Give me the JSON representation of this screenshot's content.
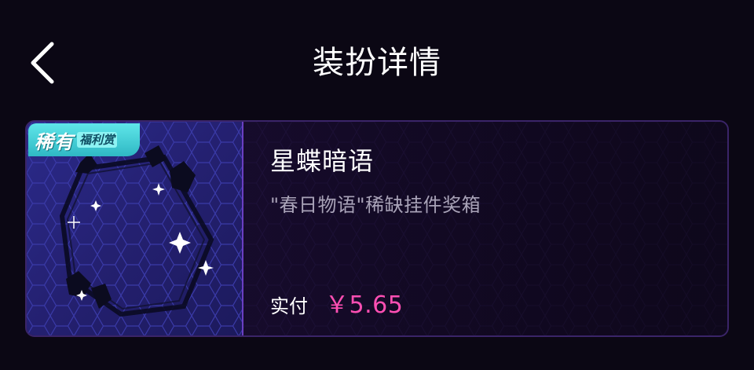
{
  "header": {
    "title": "装扮详情",
    "back_icon": "chevron-left-icon"
  },
  "item": {
    "badge_main": "稀有",
    "badge_sub": "福利赏",
    "name": "星蝶暗语",
    "description": "\"春日物语\"稀缺挂件奖箱",
    "paid_label": "实付",
    "price": "￥5.65"
  },
  "colors": {
    "background": "#0b0714",
    "price": "#ff4fb3",
    "badge": "#3fd0d8",
    "card_border": "#3a2468"
  }
}
